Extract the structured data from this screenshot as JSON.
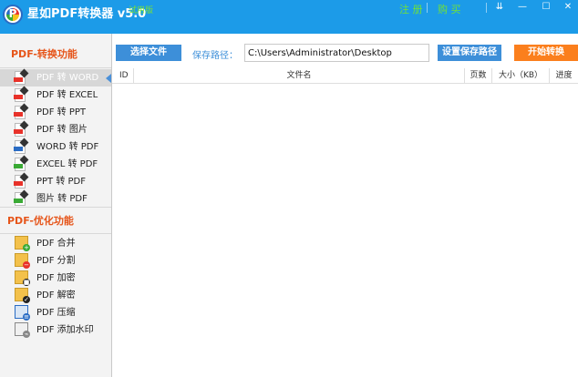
{
  "titlebar": {
    "logo_letter": "P",
    "title": "星如PDF转换器 v5.0",
    "edition": "试用版",
    "register": "注 册",
    "buy": "购 买",
    "menu_glyph": "⇊",
    "minimize_glyph": "—",
    "maximize_glyph": "☐",
    "close_glyph": "✕"
  },
  "sidebar": {
    "convert_section": "PDF-转换功能",
    "convert_items": [
      {
        "label": "PDF 转 WORD",
        "icon": "pdf-file-icon",
        "tag_color": "#e8322a"
      },
      {
        "label": "PDF 转 EXCEL",
        "icon": "pdf-file-icon",
        "tag_color": "#e8322a"
      },
      {
        "label": "PDF 转 PPT",
        "icon": "pdf-file-icon",
        "tag_color": "#e8322a"
      },
      {
        "label": "PDF 转 图片",
        "icon": "pdf-file-icon",
        "tag_color": "#e8322a"
      },
      {
        "label": "WORD 转 PDF",
        "icon": "doc-file-icon",
        "tag_color": "#2a6cc4"
      },
      {
        "label": "EXCEL 转 PDF",
        "icon": "xls-file-icon",
        "tag_color": "#3aaa35"
      },
      {
        "label": "PPT 转 PDF",
        "icon": "ppt-file-icon",
        "tag_color": "#e8322a"
      },
      {
        "label": "图片 转 PDF",
        "icon": "jpg-file-icon",
        "tag_color": "#3aaa35"
      }
    ],
    "optimize_section": "PDF-优化功能",
    "optimize_items": [
      {
        "label": "PDF 合并",
        "icon": "merge-folder-icon",
        "badge_color": "#3aaa35",
        "badge": "+"
      },
      {
        "label": "PDF 分割",
        "icon": "split-folder-icon",
        "badge_color": "#e8322a",
        "badge": "−"
      },
      {
        "label": "PDF 加密",
        "icon": "lock-folder-icon",
        "badge_color": "#222222",
        "badge": "■"
      },
      {
        "label": "PDF 解密",
        "icon": "unlock-folder-icon",
        "badge_color": "#222222",
        "badge": "✓"
      },
      {
        "label": "PDF 压缩",
        "icon": "compress-icon",
        "badge_color": "#2a6cc4",
        "badge": "≡"
      },
      {
        "label": "PDF 添加水印",
        "icon": "watermark-icon",
        "badge_color": "#888888",
        "badge": "⌁"
      }
    ]
  },
  "toolbar": {
    "select_file": "选择文件",
    "save_path_label": "保存路径：",
    "save_path_value": "C:\\Users\\Administrator\\Desktop",
    "set_save_path": "设置保存路径",
    "start": "开始转换"
  },
  "table": {
    "columns": [
      "ID",
      "文件名",
      "页数",
      "大小（KB）",
      "进度"
    ]
  },
  "colors": {
    "titlebar": "#1c9be8",
    "accent_blue": "#3d8fd9",
    "accent_orange": "#fb7f1d",
    "section_title": "#e6551a"
  }
}
